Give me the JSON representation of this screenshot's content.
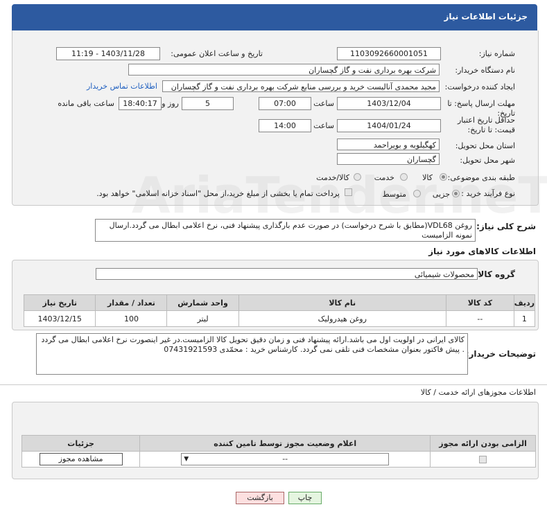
{
  "header": {
    "title": "جزئیات اطلاعات نیاز"
  },
  "form": {
    "need_number_label": "شماره نیاز:",
    "need_number": "1103092660001051",
    "announce_label": "تاریخ و ساعت اعلان عمومی:",
    "announce_value": "1403/11/28 - 11:19",
    "buyer_org_label": "نام دستگاه خریدار:",
    "buyer_org": "شرکت بهره برداری نفت و گاز گچساران",
    "creator_label": "ایجاد کننده درخواست:",
    "creator": "مجید محمدی آنالیست خرید و بررسی منابع شرکت بهره برداری نفت و گاز گچساران",
    "contact_link": "اطلاعات تماس خریدار",
    "deadline_label": "مهلت ارسال پاسخ: تا تاریخ:",
    "deadline_date": "1403/12/04",
    "time_label": "ساعت",
    "deadline_time": "07:00",
    "days_value": "5",
    "days_label": "روز و",
    "remaining_time": "18:40:17",
    "remaining_label": "ساعت باقی مانده",
    "validity_label": "حداقل تاریخ اعتبار قیمت: تا تاریخ:",
    "validity_date": "1404/01/24",
    "validity_time": "14:00",
    "province_label": "استان محل تحویل:",
    "province": "کهگیلویه و بویراحمد",
    "city_label": "شهر محل تحویل:",
    "city": "گچساران",
    "category_label": "طبقه بندی موضوعی:",
    "category_options": [
      "کالا",
      "خدمت",
      "کالا/خدمت"
    ],
    "process_label": "نوع فرآیند خرید :",
    "process_options": [
      "جزیی",
      "متوسط"
    ],
    "payment_note": "پرداخت تمام یا بخشی از مبلغ خرید،از محل \"اسناد خزانه اسلامی\" خواهد بود."
  },
  "description": {
    "label": "شرح کلی نیاز:",
    "text": "روغن VDL68(مطابق با شرح درخواست) در صورت عدم بارگذاری پیشنهاد فنی، نرخ اعلامی ابطال می گردد.ارسال نمونه الزامیست"
  },
  "goods": {
    "title": "اطلاعات کالاهای مورد نیاز",
    "group_label": "گروه کالا:",
    "group_value": "محصولات شیمیائی",
    "columns": [
      "ردیف",
      "کد کالا",
      "نام کالا",
      "واحد شمارش",
      "تعداد / مقدار",
      "تاریخ نیاز"
    ],
    "rows": [
      {
        "idx": "1",
        "code": "--",
        "name": "روغن هیدرولیک",
        "unit": "لیتر",
        "qty": "100",
        "date": "1403/12/15"
      }
    ]
  },
  "buyer_notes": {
    "label": "توضیحات خریدار:",
    "text": "کالای ایرانی در اولویت اول می باشد.ارائه پیشنهاد فنی و زمان دقیق تحویل کالا الزامیست.در غیر اینصورت نرخ اعلامی ابطال می گردد . پیش فاکتور بعنوان مشخصات فنی تلقی نمی گردد. کارشناس خرید : محمّدی  07431921593"
  },
  "permits": {
    "title": "اطلاعات مجوزهای ارائه خدمت / کالا",
    "columns": [
      "الزامی بودن ارائه مجوز",
      "اعلام وضعیت مجوز توسط تامین کننده",
      "جزئیات"
    ],
    "select_value": "--",
    "view_button": "مشاهده مجوز"
  },
  "buttons": {
    "print": "چاپ",
    "back": "بازگشت"
  },
  "watermark": "AriaTender.neT"
}
